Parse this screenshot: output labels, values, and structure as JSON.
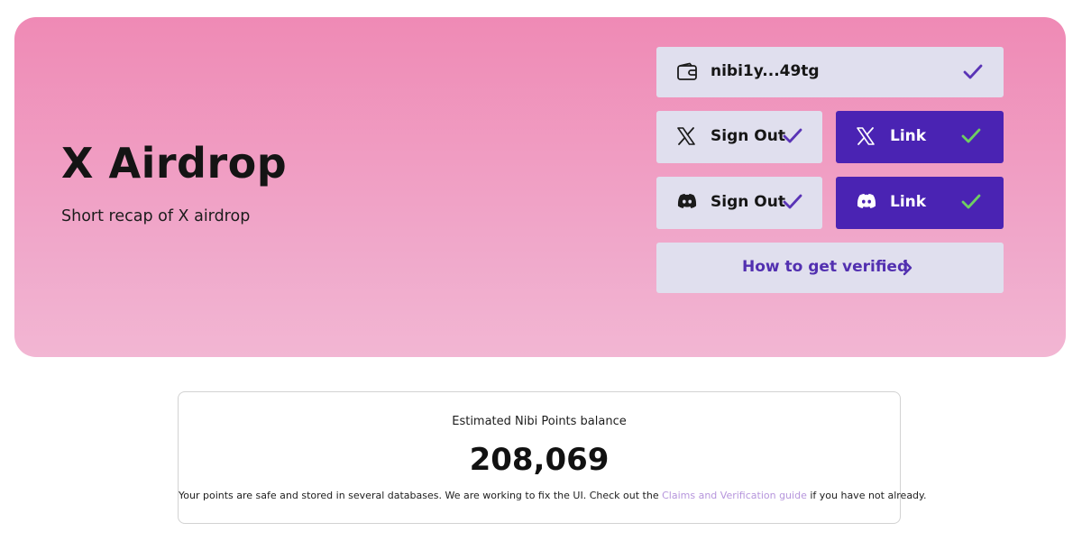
{
  "hero": {
    "title": "X Airdrop",
    "subtitle": "Short recap of X airdrop"
  },
  "wallet": {
    "address": "nibi1y...49tg",
    "icon": "wallet-icon",
    "status_icon": "check-icon"
  },
  "x_account": {
    "signout_label": "Sign Out",
    "link_label": "Link",
    "icon": "x-logo-icon"
  },
  "discord_account": {
    "signout_label": "Sign Out",
    "link_label": "Link",
    "icon": "discord-logo-icon"
  },
  "howto": {
    "label": "How to get verified",
    "icon": "chevron-right-icon"
  },
  "balance": {
    "label": "Estimated Nibi Points balance",
    "value": "208,069",
    "note_before": "Your points are safe and stored in several databases. We are working to fix the UI. Check out the ",
    "note_link": "Claims and Verification guide",
    "note_after": " if you have not already."
  },
  "colors": {
    "hero_gradient_top": "#ef8ab5",
    "hero_gradient_bottom": "#f2b6d3",
    "button_light": "#e0dfee",
    "button_dark": "#4a23b3",
    "check_purple": "#5a34b6",
    "check_green": "#6fce62",
    "link_text": "#b695dc"
  }
}
